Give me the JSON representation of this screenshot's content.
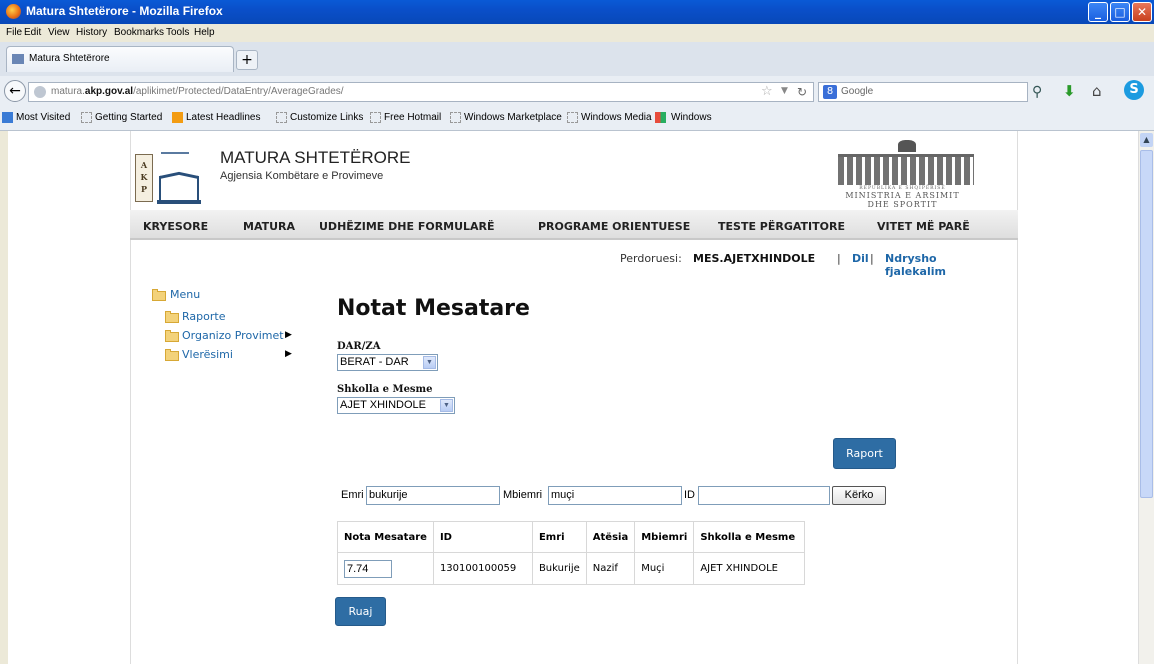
{
  "window": {
    "title": "Matura Shtetërore - Mozilla Firefox"
  },
  "menubar": [
    "File",
    "Edit",
    "View",
    "History",
    "Bookmarks",
    "Tools",
    "Help"
  ],
  "tab": {
    "title": "Matura Shtetërore"
  },
  "urlbar": {
    "url_prefix": "matura.",
    "url_domain": "akp.gov.al",
    "url_path": "/aplikimet/Protected/DataEntry/AverageGrades/"
  },
  "searchbar": {
    "placeholder": "Google"
  },
  "bookmarks": [
    "Most Visited",
    "Getting Started",
    "Latest Headlines",
    "Customize Links",
    "Free Hotmail",
    "Windows Marketplace",
    "Windows Media",
    "Windows"
  ],
  "site": {
    "logo_letters": "A K P",
    "title": "MATURA SHTETËRORE",
    "subtitle": "Agjensia Kombëtare e Provimeve",
    "ministry_line1": "REPUBLIKA E SHQIPËRISË",
    "ministry_line2": "MINISTRIA E ARSIMIT",
    "ministry_line3": "DHE SPORTIT"
  },
  "nav": [
    "KRYESORE",
    "MATURA",
    "UDHËZIME DHE FORMULARË",
    "PROGRAME ORIENTUESE",
    "TESTE PËRGATITORE",
    "VITET MË PARË"
  ],
  "user": {
    "label": "Perdoruesi:",
    "name": "MES.AJETXHINDOLE",
    "sep": "|",
    "logout": "Dil",
    "change_password": "Ndrysho fjalekalim"
  },
  "sidemenu": {
    "root": "Menu",
    "items": [
      {
        "label": "Raporte",
        "has_submenu": false
      },
      {
        "label": "Organizo Provimet",
        "has_submenu": true
      },
      {
        "label": "Vlerësimi",
        "has_submenu": true
      }
    ]
  },
  "form": {
    "heading": "Notat Mesatare",
    "dar_label": "DAR/ZA",
    "dar_value": "BERAT - DAR",
    "school_label": "Shkolla e Mesme",
    "school_value": "AJET XHINDOLE",
    "report_button": "Raport",
    "search": {
      "first_name_label": "Emri",
      "first_name_value": "bukurije",
      "last_name_label": "Mbiemri",
      "last_name_value": "muçi",
      "id_label": "ID",
      "id_value": "",
      "search_button": "Kërko"
    },
    "save_button": "Ruaj"
  },
  "table": {
    "headers": [
      "Nota Mesatare",
      "ID",
      "Emri",
      "Atësia",
      "Mbiemri",
      "Shkolla e Mesme"
    ],
    "rows": [
      {
        "grade": "7.74",
        "id": "130100100059",
        "first_name": "Bukurije",
        "father": "Nazif",
        "last_name": "Muçi",
        "school": "AJET XHINDOLE"
      }
    ]
  },
  "colors": {
    "link": "#1e67a8",
    "button": "#2e6da4",
    "titlebar": "#0a5ad6"
  }
}
